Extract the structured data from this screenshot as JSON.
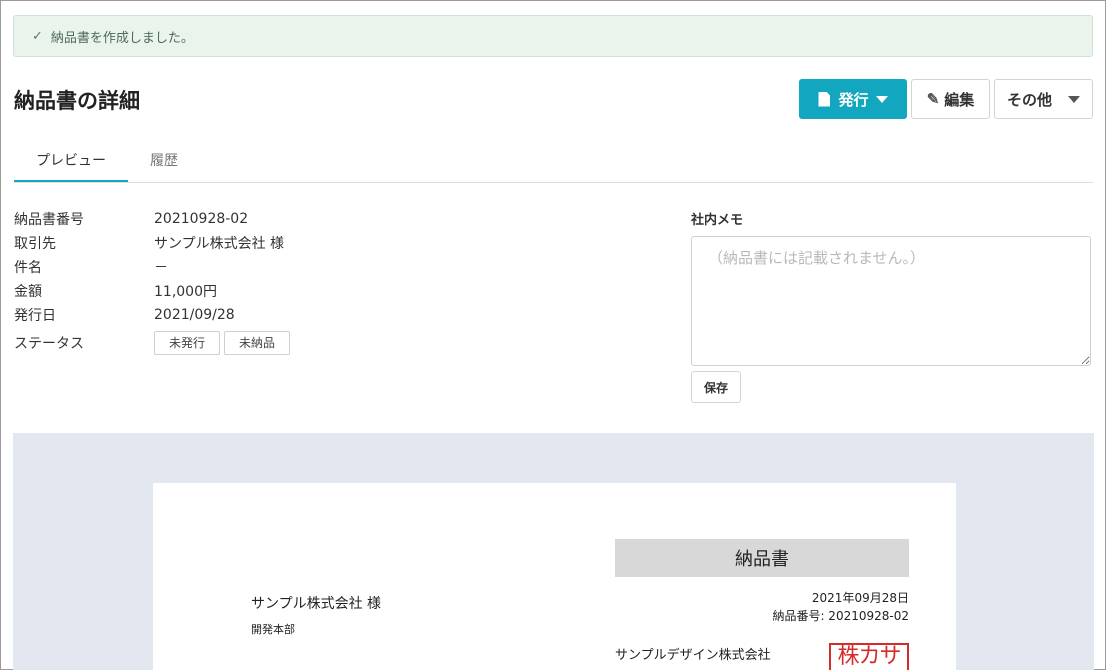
{
  "alert": {
    "icon": "check-icon",
    "message": "納品書を作成しました。"
  },
  "page": {
    "title": "納品書の詳細"
  },
  "actions": {
    "issue_label": "発行",
    "edit_label": "編集",
    "other_label": "その他"
  },
  "tabs": [
    {
      "label": "プレビュー"
    },
    {
      "label": "履歴"
    }
  ],
  "details": {
    "number": {
      "label": "納品書番号",
      "value": "20210928-02"
    },
    "client": {
      "label": "取引先",
      "value": "サンプル株式会社 様"
    },
    "subject": {
      "label": "件名",
      "value": "－"
    },
    "amount": {
      "label": "金額",
      "value": "11,000円"
    },
    "issue_date": {
      "label": "発行日",
      "value": "2021/09/28"
    },
    "status": {
      "label": "ステータス",
      "badges": [
        "未発行",
        "未納品"
      ]
    }
  },
  "memo": {
    "label": "社内メモ",
    "placeholder": "（納品書には記載されません。）",
    "save_label": "保存"
  },
  "preview": {
    "title": "納品書",
    "client_name": "サンプル株式会社 様",
    "client_department": "開発本部",
    "date": "2021年09月28日",
    "number": "納品番号: 20210928-02",
    "company": "サンプルデザイン株式会社",
    "seal_text": "株カサ"
  },
  "colors": {
    "primary": "#12a6bf",
    "link": "#12889c",
    "alert_bg": "#eaf4ed",
    "preview_bg": "#e2e7f0",
    "seal": "#d62b2b"
  }
}
